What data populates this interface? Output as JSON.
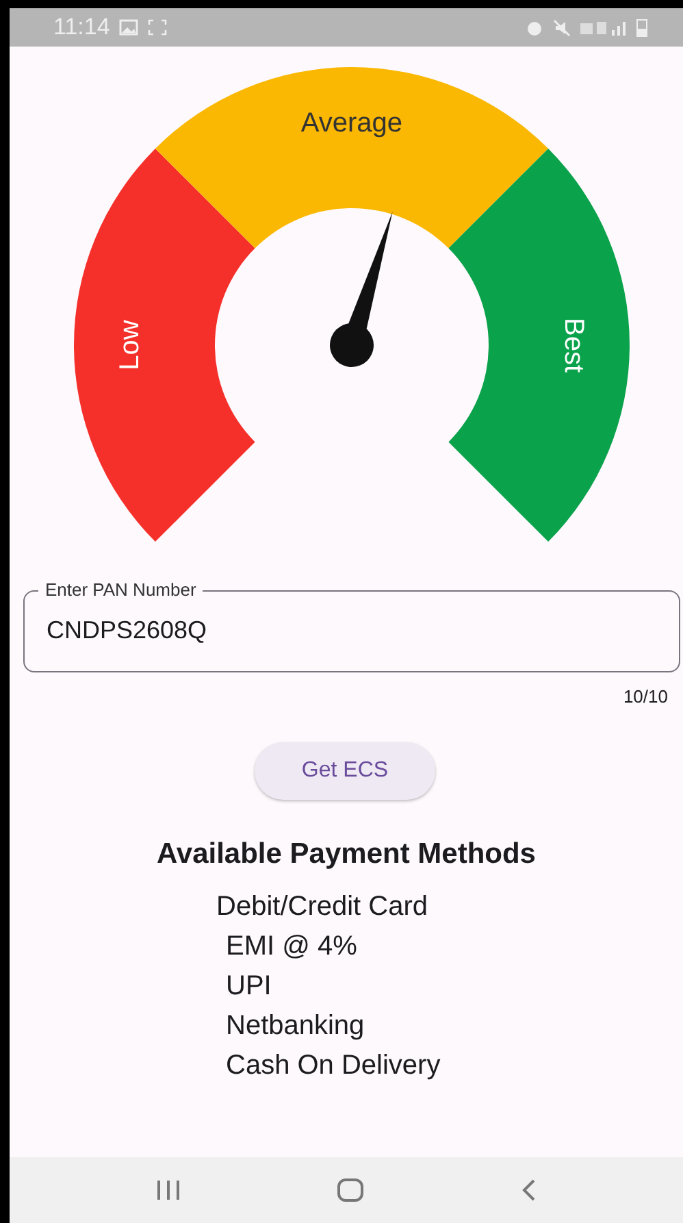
{
  "status_bar": {
    "time": "11:14"
  },
  "gauge": {
    "segments": [
      {
        "label": "Low",
        "color": "#f5302b"
      },
      {
        "label": "Average",
        "color": "#fbb802"
      },
      {
        "label": "Best",
        "color": "#0aa24a"
      }
    ]
  },
  "pan_field": {
    "label": "Enter PAN Number",
    "value": "CNDPS2608Q",
    "counter": "10/10"
  },
  "get_ecs_button": "Get ECS",
  "payment_methods": {
    "title": "Available Payment Methods",
    "items": [
      "Debit/Credit Card",
      "EMI @ 4%",
      "UPI",
      "Netbanking",
      "Cash On Delivery"
    ]
  }
}
